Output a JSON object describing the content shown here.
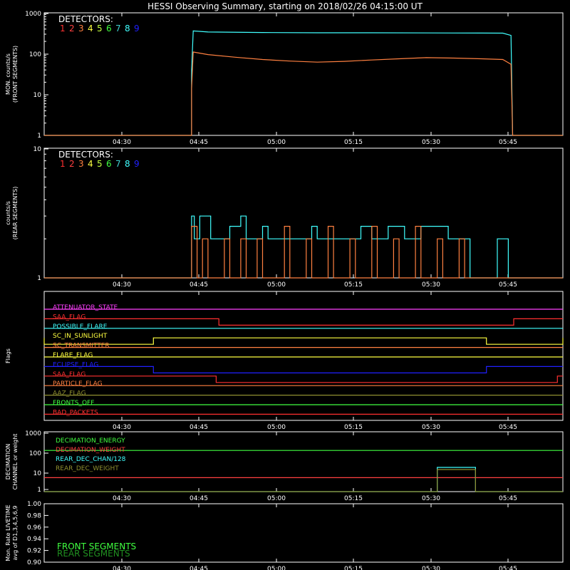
{
  "title": "HESSI Observing Summary, starting on 2018/02/26 04:15:00 UT",
  "colors": {
    "background": "#000000",
    "axes": "#ffffff",
    "detectors": [
      "#ff3030",
      "#ff4040",
      "#ff8040",
      "#ffff40",
      "#c0ff40",
      "#40ff40",
      "#40d0d0",
      "#40ffff",
      "#2020ff"
    ]
  },
  "time_ticks": [
    "04:30",
    "04:45",
    "05:00",
    "05:15",
    "05:30",
    "05:45"
  ],
  "legends": {
    "detectors_header": "DETECTORS:",
    "detector_numbers": [
      "1",
      "2",
      "3",
      "4",
      "5",
      "6",
      "7",
      "8",
      "9"
    ]
  },
  "chart_data": [
    {
      "type": "line",
      "id": "front",
      "ylabel_lines": [
        "MON. counts/s",
        "(FRONT SEGMENTS)"
      ],
      "yscale": "log",
      "ylim": [
        1,
        1000
      ],
      "ytick_labels": [
        "1",
        "10",
        "100",
        "1000"
      ],
      "xlim_minutes": [
        0,
        95
      ],
      "series": [
        {
          "color": "#40ffff",
          "points": [
            [
              0,
              1
            ],
            [
              27,
              1
            ],
            [
              27,
              40
            ],
            [
              27.3,
              360
            ],
            [
              30,
              340
            ],
            [
              40,
              330
            ],
            [
              50,
              325
            ],
            [
              60,
              325
            ],
            [
              70,
              322
            ],
            [
              80,
              320
            ],
            [
              84,
              318
            ],
            [
              85.5,
              280
            ],
            [
              85.8,
              1
            ],
            [
              95,
              1
            ]
          ]
        },
        {
          "color": "#ff8040",
          "points": [
            [
              0,
              1
            ],
            [
              27,
              1
            ],
            [
              27,
              14
            ],
            [
              27.3,
              110
            ],
            [
              30,
              95
            ],
            [
              35,
              82
            ],
            [
              40,
              72
            ],
            [
              45,
              66
            ],
            [
              50,
              62
            ],
            [
              55,
              65
            ],
            [
              60,
              70
            ],
            [
              65,
              75
            ],
            [
              70,
              80
            ],
            [
              75,
              78
            ],
            [
              80,
              75
            ],
            [
              84,
              72
            ],
            [
              85.5,
              55
            ],
            [
              85.8,
              1
            ],
            [
              95,
              1
            ]
          ]
        }
      ]
    },
    {
      "type": "line",
      "id": "rear",
      "ylabel_lines": [
        "counts/s",
        "(REAR SEGMENTS)"
      ],
      "yscale": "log",
      "ylim": [
        1,
        10
      ],
      "ytick_labels": [
        "1",
        "10"
      ],
      "xlim_minutes": [
        0,
        95
      ],
      "series": [
        {
          "color": "#40ffff",
          "points": [
            [
              0,
              1
            ],
            [
              27,
              1
            ],
            [
              27,
              3
            ],
            [
              27.5,
              3
            ],
            [
              27.5,
              2
            ],
            [
              28.5,
              2
            ],
            [
              28.5,
              3
            ],
            [
              30.5,
              3
            ],
            [
              30.5,
              2
            ],
            [
              34,
              2
            ],
            [
              34,
              2.5
            ],
            [
              36,
              2.5
            ],
            [
              36,
              3
            ],
            [
              37,
              3
            ],
            [
              37,
              2
            ],
            [
              40,
              2
            ],
            [
              40,
              2.5
            ],
            [
              41,
              2.5
            ],
            [
              41,
              2
            ],
            [
              49,
              2
            ],
            [
              49,
              2.5
            ],
            [
              50,
              2.5
            ],
            [
              50,
              2
            ],
            [
              58,
              2
            ],
            [
              58,
              2.5
            ],
            [
              60,
              2.5
            ],
            [
              60,
              2
            ],
            [
              63,
              2
            ],
            [
              63,
              2.5
            ],
            [
              66,
              2.5
            ],
            [
              66,
              2
            ],
            [
              69,
              2
            ],
            [
              69,
              2.5
            ],
            [
              74,
              2.5
            ],
            [
              74,
              2
            ],
            [
              78,
              2
            ],
            [
              78,
              1
            ],
            [
              83,
              1
            ],
            [
              83,
              2
            ],
            [
              85,
              2
            ],
            [
              85,
              1
            ],
            [
              95,
              1
            ]
          ]
        },
        {
          "color": "#ff8040",
          "points": [
            [
              0,
              1
            ],
            [
              27,
              1
            ],
            [
              27,
              2.5
            ],
            [
              28,
              2.5
            ],
            [
              28,
              1
            ],
            [
              29,
              1
            ],
            [
              29,
              2
            ],
            [
              30,
              2
            ],
            [
              30,
              1
            ],
            [
              33,
              1
            ],
            [
              33,
              2
            ],
            [
              34,
              2
            ],
            [
              34,
              1
            ],
            [
              36,
              1
            ],
            [
              36,
              2
            ],
            [
              37,
              2
            ],
            [
              37,
              1
            ],
            [
              39,
              1
            ],
            [
              39,
              2
            ],
            [
              40,
              2
            ],
            [
              40,
              1
            ],
            [
              44,
              1
            ],
            [
              44,
              2.5
            ],
            [
              45,
              2.5
            ],
            [
              45,
              1
            ],
            [
              48,
              1
            ],
            [
              48,
              2
            ],
            [
              49,
              2
            ],
            [
              49,
              1
            ],
            [
              52,
              1
            ],
            [
              52,
              2.5
            ],
            [
              53,
              2.5
            ],
            [
              53,
              1
            ],
            [
              56,
              1
            ],
            [
              56,
              2
            ],
            [
              57,
              2
            ],
            [
              57,
              1
            ],
            [
              60,
              1
            ],
            [
              60,
              2.5
            ],
            [
              61,
              2.5
            ],
            [
              61,
              1
            ],
            [
              64,
              1
            ],
            [
              64,
              2
            ],
            [
              65,
              2
            ],
            [
              65,
              1
            ],
            [
              68,
              1
            ],
            [
              68,
              2.5
            ],
            [
              69,
              2.5
            ],
            [
              69,
              1
            ],
            [
              72,
              1
            ],
            [
              72,
              2
            ],
            [
              73,
              2
            ],
            [
              73,
              1
            ],
            [
              76,
              1
            ],
            [
              76,
              2
            ],
            [
              77,
              2
            ],
            [
              77,
              1
            ],
            [
              95,
              1
            ]
          ]
        }
      ]
    },
    {
      "type": "line",
      "id": "flags",
      "ylabel_lines": [
        "Flags"
      ],
      "xlim_minutes": [
        0,
        95
      ],
      "flags": [
        {
          "label": "ATTENUATOR_STATE",
          "color": "#ff40ff",
          "low_segments": []
        },
        {
          "label": "SAA_FLAG",
          "color": "#ff3030",
          "low_segments": [
            [
              32,
              86
            ]
          ]
        },
        {
          "label": "POSSIBLE_FLARE",
          "color": "#40ffff",
          "low_segments": []
        },
        {
          "label": "SC_IN_SUNLIGHT",
          "color": "#ffff40",
          "low_segments": [
            [
              0,
              20
            ],
            [
              81,
              95
            ]
          ]
        },
        {
          "label": "SC_TRANSMITTER",
          "color": "#ff8040",
          "low_segments": []
        },
        {
          "label": "FLARE_FLAG",
          "color": "#ffff40",
          "low_segments": []
        },
        {
          "label": "ECLIPSE_FLAG",
          "color": "#2020ff",
          "low_segments": [
            [
              20,
              81
            ]
          ]
        },
        {
          "label": "SAA_FLAG",
          "color": "#ff3030",
          "low_segments": [
            [
              31.5,
              94
            ]
          ]
        },
        {
          "label": "PARTICLE_FLAG",
          "color": "#ff8040",
          "low_segments": []
        },
        {
          "label": "AAZ_FLAG",
          "color": "#909030",
          "low_segments": []
        },
        {
          "label": "FRONTS_OFF",
          "color": "#40ff40",
          "low_segments": []
        },
        {
          "label": "BAD_PACKETS",
          "color": "#ff3030",
          "low_segments": []
        }
      ]
    },
    {
      "type": "line",
      "id": "decimation",
      "ylabel_lines": [
        "DECIMATION",
        "CHANNEL or weight"
      ],
      "yscale": "log",
      "ylim": [
        0.3,
        1000
      ],
      "ytick_labels": [
        "1",
        "10",
        "100",
        "1000"
      ],
      "xlim_minutes": [
        0,
        95
      ],
      "series": [
        {
          "name": "DECIMATION_ENERGY",
          "color": "#40ff40",
          "points": [
            [
              0,
              80
            ],
            [
              95,
              80
            ]
          ]
        },
        {
          "name": "DECIMATION_WEIGHT",
          "color": "#ff4040",
          "points": [
            [
              0,
              2
            ],
            [
              95,
              2
            ]
          ]
        },
        {
          "name": "REAR_DEC_CHAN/128",
          "color": "#40ffff",
          "points": [
            [
              0,
              0.3
            ],
            [
              72,
              0.3
            ],
            [
              72,
              8
            ],
            [
              79,
              8
            ],
            [
              79,
              0.3
            ],
            [
              95,
              0.3
            ]
          ]
        },
        {
          "name": "REAR_DEC_WEIGHT",
          "color": "#909030",
          "points": [
            [
              0,
              0.3
            ],
            [
              72,
              0.3
            ],
            [
              72,
              6
            ],
            [
              79,
              6
            ],
            [
              79,
              0.3
            ],
            [
              95,
              0.3
            ]
          ]
        }
      ]
    },
    {
      "type": "line",
      "id": "livetime",
      "ylabel_lines": [
        "Mon. Rate LIVETIME",
        "avg of D1,3,4,5,6,9"
      ],
      "ylim": [
        0.9,
        1.0
      ],
      "ytick_labels": [
        "0.90",
        "0.92",
        "0.94",
        "0.96",
        "0.98",
        "1.00"
      ],
      "xlim_minutes": [
        0,
        95
      ],
      "series": [
        {
          "name": "FRONT SEGMENTS",
          "color": "#40ff40",
          "points": []
        },
        {
          "name": "REAR SEGMENTS",
          "color": "#209020",
          "points": []
        }
      ]
    }
  ]
}
